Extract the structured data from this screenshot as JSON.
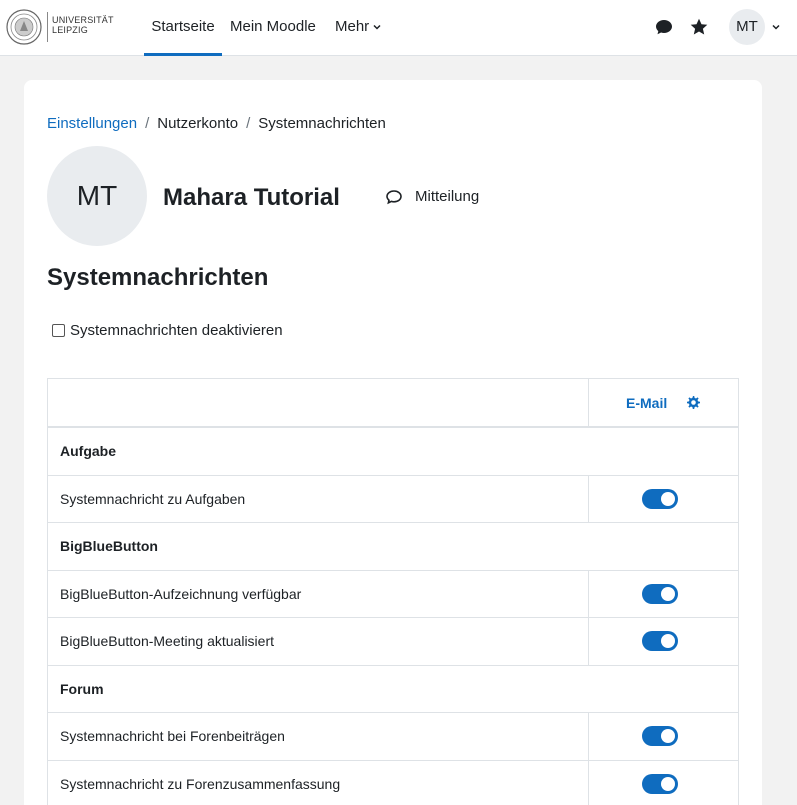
{
  "navbar": {
    "logo_line1": "UNIVERSITÄT",
    "logo_line2": "LEIPZIG",
    "home_label": "Startseite",
    "mymoodle_label": "Mein Moodle",
    "more_label": "Mehr",
    "avatar_initials": "MT",
    "icons": [
      "chat-icon",
      "star-icon",
      "chevron-down-icon"
    ]
  },
  "breadcrumb": {
    "items": [
      "Einstellungen",
      "Nutzerkonto",
      "Systemnachrichten"
    ],
    "separator": "/"
  },
  "profile": {
    "initials": "MT",
    "name": "Mahara Tutorial",
    "message_label": "Mitteilung"
  },
  "page": {
    "heading": "Systemnachrichten",
    "disable_label": "Systemnachrichten deaktivieren",
    "disable_checked": false
  },
  "table": {
    "email_header": "E-Mail",
    "rows": [
      {
        "type": "group",
        "label": "Aufgabe"
      },
      {
        "type": "item",
        "label": "Systemnachricht zu Aufgaben",
        "email_enabled": true
      },
      {
        "type": "group",
        "label": "BigBlueButton"
      },
      {
        "type": "item",
        "label": "BigBlueButton-Aufzeichnung verfügbar",
        "email_enabled": true
      },
      {
        "type": "item",
        "label": "BigBlueButton-Meeting aktualisiert",
        "email_enabled": true
      },
      {
        "type": "group",
        "label": "Forum"
      },
      {
        "type": "item",
        "label": "Systemnachricht bei Forenbeiträgen",
        "email_enabled": true
      },
      {
        "type": "item",
        "label": "Systemnachricht zu Forenzusammenfassung",
        "email_enabled": true
      }
    ]
  },
  "colors": {
    "accent": "#0f6cbf",
    "page_background": "#f2f2f2",
    "avatar_background": "#e9ecef"
  }
}
